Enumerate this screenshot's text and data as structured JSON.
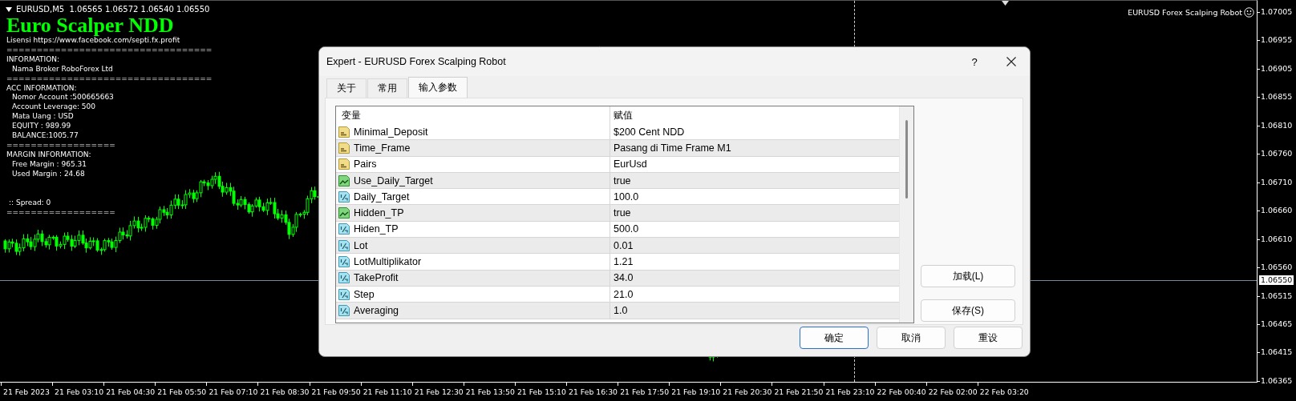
{
  "chart": {
    "symbol_line": "EURUSD,M5  1.06565 1.06572 1.06540 1.06550",
    "ea_name": "EURUSD Forex Scalping Robot",
    "price_ticks": [
      "1.07005",
      "1.06955",
      "1.06905",
      "1.06855",
      "1.06810",
      "1.06760",
      "1.06710",
      "1.06660",
      "1.06610",
      "1.06560",
      "1.06515",
      "1.06465",
      "1.06415",
      "1.06365"
    ],
    "current_price": "1.06550",
    "time_ticks": [
      "21 Feb 2023",
      "21 Feb 03:10",
      "21 Feb 04:30",
      "21 Feb 05:50",
      "21 Feb 07:10",
      "21 Feb 08:30",
      "21 Feb 09:50",
      "21 Feb 11:10",
      "21 Feb 12:30",
      "21 Feb 13:50",
      "21 Feb 15:10",
      "21 Feb 16:30",
      "21 Feb 17:50",
      "21 Feb 19:10",
      "21 Feb 20:30",
      "21 Feb 21:50",
      "21 Feb 23:10",
      "22 Feb 00:40",
      "22 Feb 02:00",
      "22 Feb 03:20"
    ]
  },
  "info_panel": {
    "title": "Euro Scalper NDD",
    "lines": [
      {
        "text": "Lisensi https://www.facebook.com/septi.fx.profit",
        "indented": false,
        "gap_before": false
      },
      {
        "text": "==================================",
        "indented": false,
        "gap_before": false
      },
      {
        "text": "INFORMATION:",
        "indented": false,
        "gap_before": false
      },
      {
        "text": "Nama Broker RoboForex Ltd",
        "indented": true,
        "gap_before": false
      },
      {
        "text": "==================================",
        "indented": false,
        "gap_before": false
      },
      {
        "text": "ACC INFORMATION:",
        "indented": false,
        "gap_before": false
      },
      {
        "text": "Nomor Account :500665663",
        "indented": true,
        "gap_before": false
      },
      {
        "text": "Account Leverage: 500",
        "indented": true,
        "gap_before": false
      },
      {
        "text": "Mata Uang : USD",
        "indented": true,
        "gap_before": false
      },
      {
        "text": "EQUITY : 989.99",
        "indented": true,
        "gap_before": false
      },
      {
        "text": "BALANCE:1005.77",
        "indented": true,
        "gap_before": false
      },
      {
        "text": "==================",
        "indented": false,
        "gap_before": false
      },
      {
        "text": "MARGIN INFORMATION:",
        "indented": false,
        "gap_before": false
      },
      {
        "text": "Free Margin : 965.31",
        "indented": true,
        "gap_before": false
      },
      {
        "text": "Used Margin : 24.68",
        "indented": true,
        "gap_before": false
      },
      {
        "text": ":: Spread: 0",
        "indented": false,
        "gap_before": true
      },
      {
        "text": "==================",
        "indented": false,
        "gap_before": false
      }
    ]
  },
  "dialog": {
    "title": "Expert - EURUSD Forex Scalping Robot",
    "help": "?",
    "tabs": [
      {
        "label": "关于",
        "selected": false
      },
      {
        "label": "常用",
        "selected": false
      },
      {
        "label": "输入参数",
        "selected": true
      }
    ],
    "table": {
      "columns": [
        "变量",
        "赋值"
      ],
      "rows": [
        {
          "kind": "string",
          "name": "Minimal_Deposit",
          "value": "$200 Cent NDD"
        },
        {
          "kind": "string",
          "name": "Time_Frame",
          "value": "Pasang di Time Frame M1"
        },
        {
          "kind": "string",
          "name": "Pairs",
          "value": "EurUsd"
        },
        {
          "kind": "bool",
          "name": "Use_Daily_Target",
          "value": "true"
        },
        {
          "kind": "double",
          "name": "Daily_Target",
          "value": "100.0"
        },
        {
          "kind": "bool",
          "name": "Hidden_TP",
          "value": "true"
        },
        {
          "kind": "double",
          "name": "Hiden_TP",
          "value": "500.0"
        },
        {
          "kind": "double",
          "name": "Lot",
          "value": "0.01"
        },
        {
          "kind": "double",
          "name": "LotMultiplikator",
          "value": "1.21"
        },
        {
          "kind": "double",
          "name": "TakeProfit",
          "value": "34.0"
        },
        {
          "kind": "double",
          "name": "Step",
          "value": "21.0"
        },
        {
          "kind": "double",
          "name": "Averaging",
          "value": "1.0"
        }
      ]
    },
    "side_buttons": [
      "加载(L)",
      "保存(S)"
    ],
    "buttons": [
      {
        "label": "确定",
        "default": true
      },
      {
        "label": "取消",
        "default": false
      },
      {
        "label": "重设",
        "default": false
      }
    ]
  }
}
